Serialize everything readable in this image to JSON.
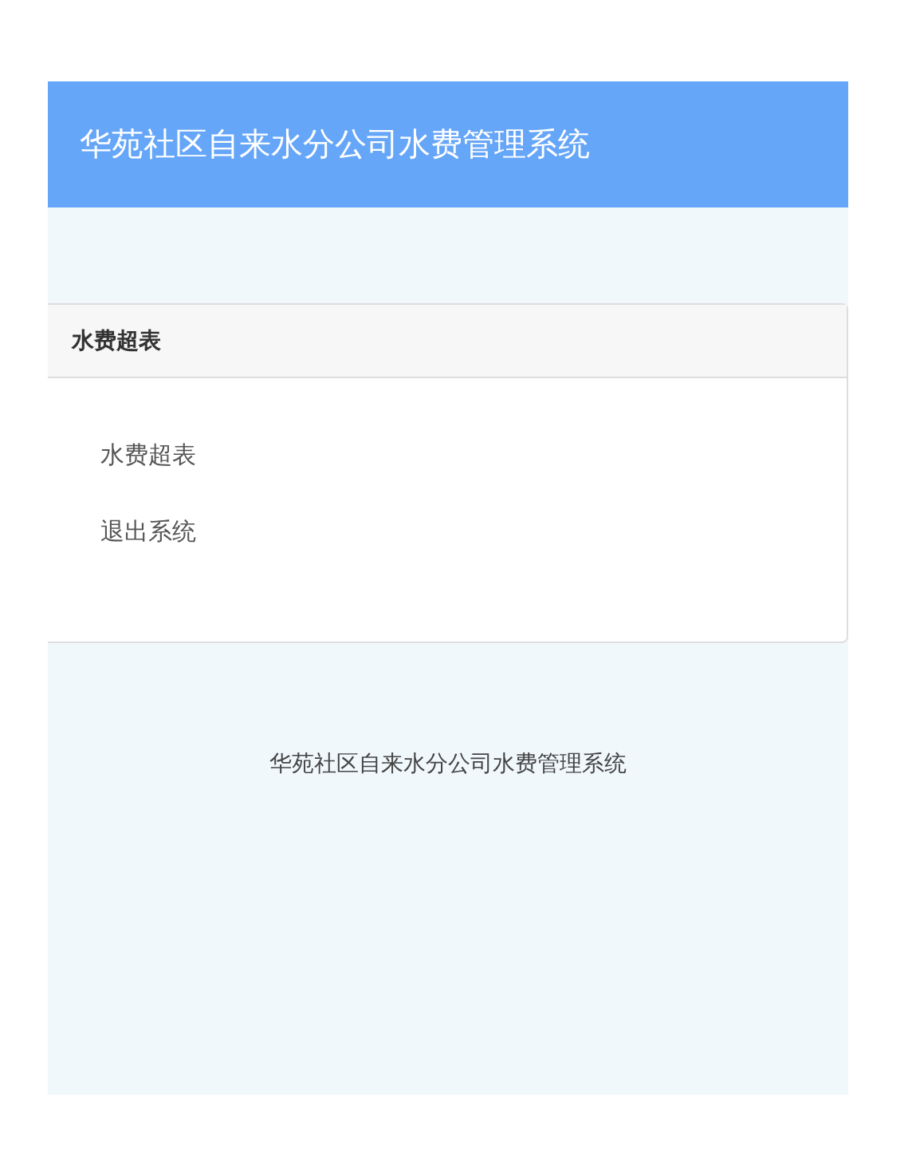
{
  "header": {
    "title": "华苑社区自来水分公司水费管理系统"
  },
  "panel": {
    "title": "水费超表",
    "items": [
      {
        "label": "水费超表"
      },
      {
        "label": "退出系统"
      }
    ]
  },
  "footer": {
    "text": "华苑社区自来水分公司水费管理系统"
  }
}
